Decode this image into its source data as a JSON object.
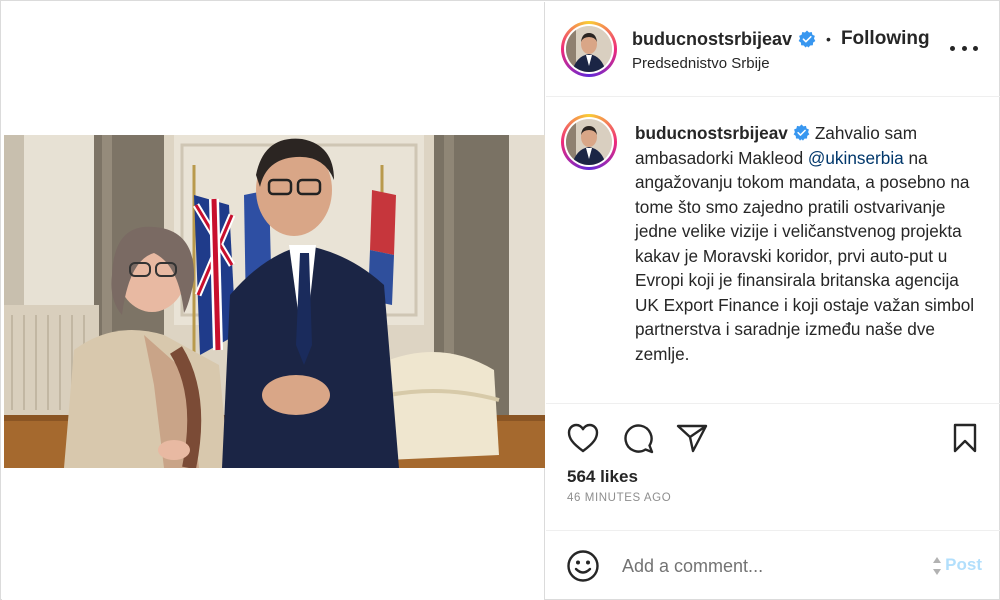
{
  "post": {
    "username": "buducnostsrbijeav",
    "follow_status": "Following",
    "separator": "•",
    "location": "Predsednistvo Srbije",
    "image_alt": "Two people posing in front of flags in a formal room"
  },
  "caption": {
    "username": "buducnostsrbijeav",
    "text_before_mention": "Zahvalio sam ambasadorki Makleod ",
    "mention": "@ukinserbia",
    "text_after_mention": " na angažovanju tokom mandata, a posebno na tome što smo zajedno pratili ostvarivanje jedne velike vizije i veličanstvenog projekta kakav je Moravski koridor, prvi auto-put u Evropi koji je finansirala britanska agencija UK Export Finance i koji ostaje važan simbol partnerstva i saradnje između naše dve zemlje."
  },
  "engagement": {
    "likes": "564 likes",
    "time_ago": "46 MINUTES AGO"
  },
  "comment": {
    "placeholder": "Add a comment...",
    "post_label": "Post"
  },
  "icons": {
    "verified": "verified-badge-icon",
    "more": "more-options-icon",
    "like": "heart-icon",
    "comment": "comment-bubble-icon",
    "share": "paper-plane-icon",
    "save": "bookmark-icon",
    "emoji": "emoji-smiley-icon"
  },
  "colors": {
    "verified_blue": "#3897f0",
    "mention_blue": "#00376b",
    "post_button_disabled": "#b2dffc",
    "meta_gray": "#8e8e8e"
  }
}
